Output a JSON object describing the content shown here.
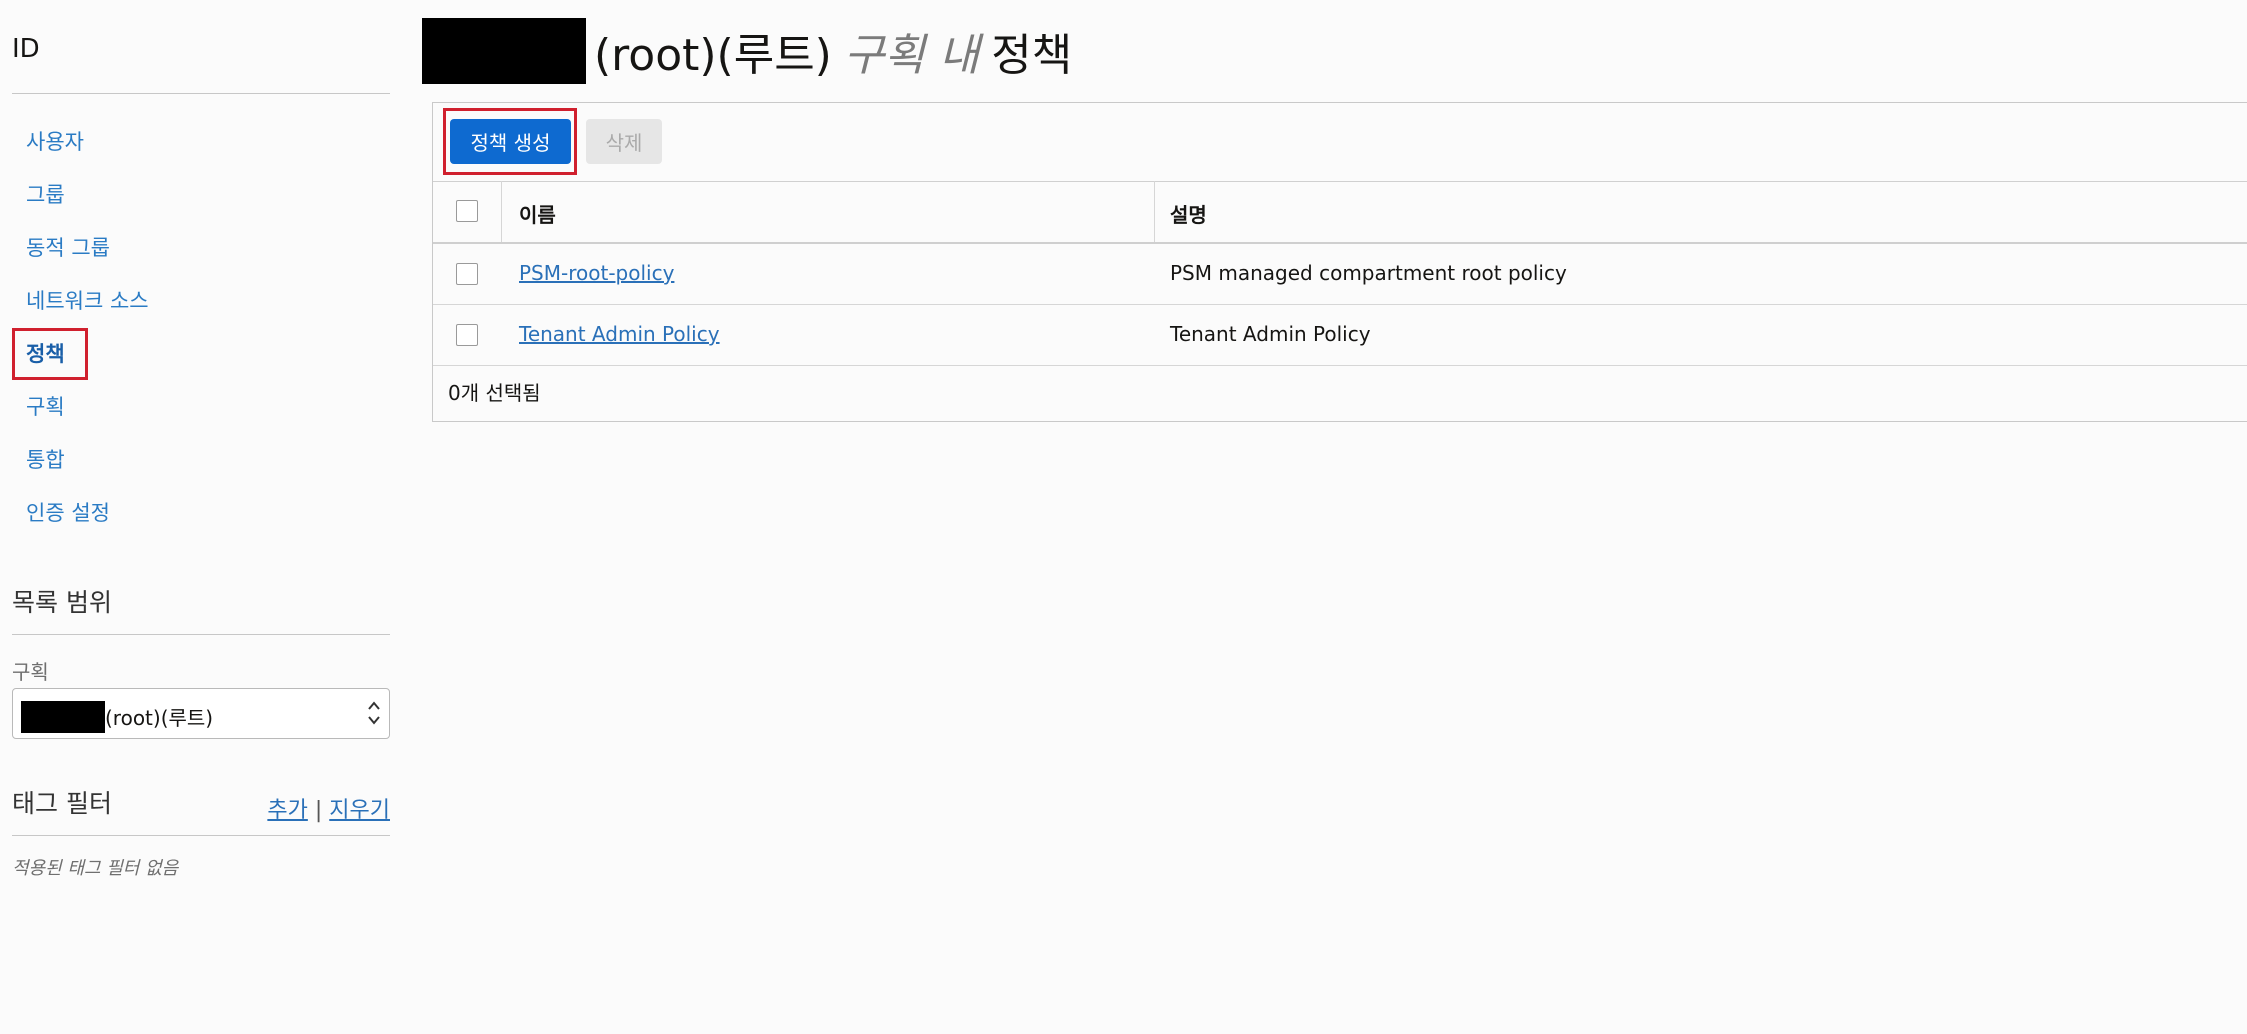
{
  "sidebar": {
    "title": "ID",
    "nav": [
      {
        "label": "사용자",
        "active": false
      },
      {
        "label": "그룹",
        "active": false
      },
      {
        "label": "동적 그룹",
        "active": false
      },
      {
        "label": "네트워크 소스",
        "active": false
      },
      {
        "label": "정책",
        "active": true
      },
      {
        "label": "구획",
        "active": false
      },
      {
        "label": "통합",
        "active": false
      },
      {
        "label": "인증 설정",
        "active": false
      }
    ],
    "list_scope": {
      "title": "목록 범위",
      "compartment_label": "구획",
      "compartment_value": "(root)(루트)"
    },
    "tag_filters": {
      "title": "태그 필터",
      "add_label": "추가",
      "separator": "|",
      "clear_label": "지우기",
      "empty_text": "적용된 태그 필터 없음"
    }
  },
  "main": {
    "title_suffix": "(root)(루트)",
    "title_scope": "구획 내",
    "title_main": "정책",
    "toolbar": {
      "create_label": "정책 생성",
      "delete_label": "삭제"
    },
    "table": {
      "columns": [
        "이름",
        "설명"
      ],
      "rows": [
        {
          "name": "PSM-root-policy",
          "description": "PSM managed compartment root policy"
        },
        {
          "name": "Tenant Admin Policy",
          "description": "Tenant Admin Policy"
        }
      ],
      "footer": "0개 선택됨"
    }
  },
  "colors": {
    "link": "#2a70b8",
    "primary": "#0e6ad0",
    "highlight": "#d0202e"
  }
}
